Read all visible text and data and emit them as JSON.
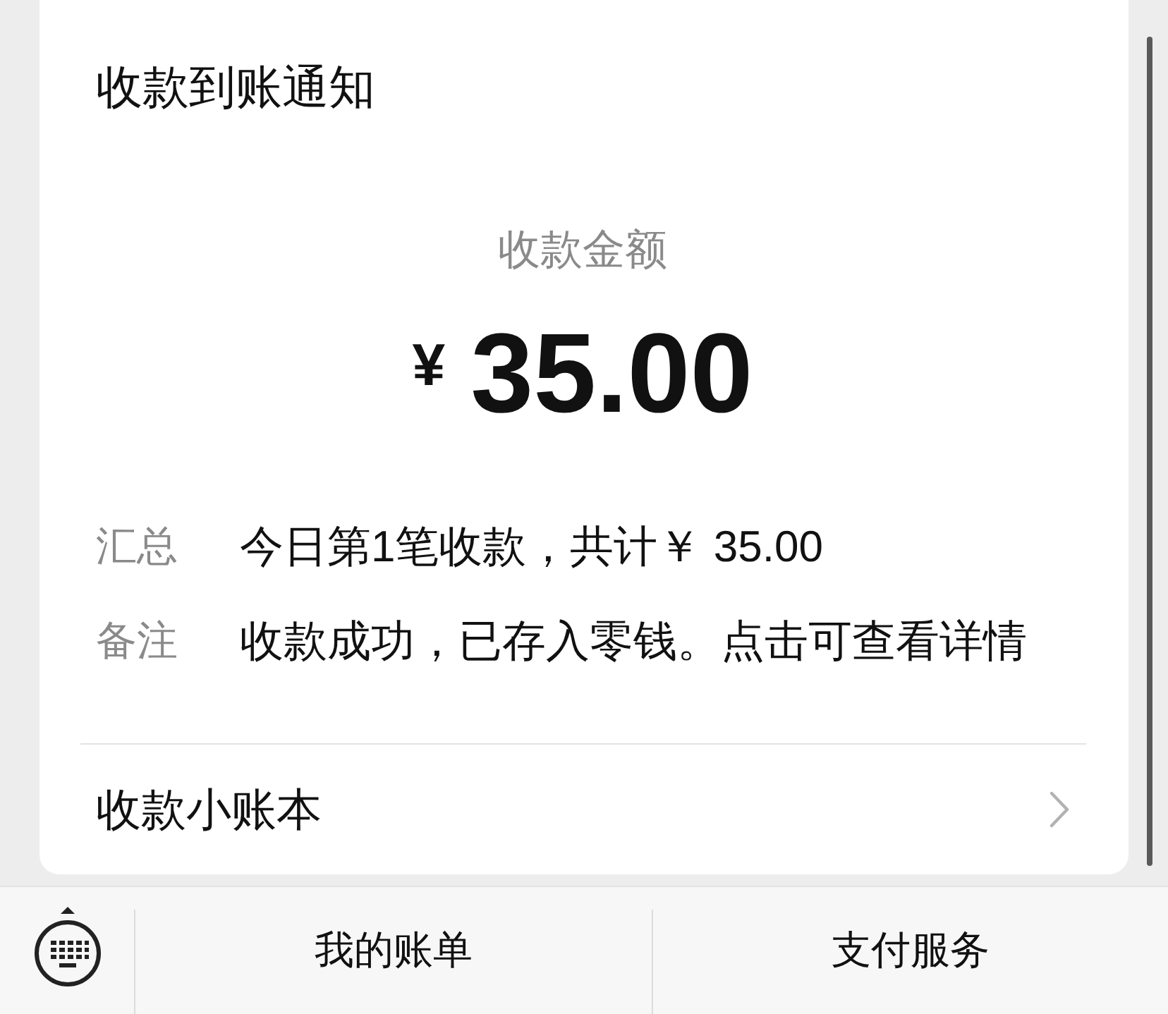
{
  "card": {
    "title": "收款到账通知",
    "amount_label": "收款金额",
    "currency": "¥",
    "amount": "35.00",
    "details": [
      {
        "label": "汇总",
        "value": "今日第1笔收款，共计￥ 35.00"
      },
      {
        "label": "备注",
        "value": "收款成功，已存入零钱。点击可查看详情"
      }
    ],
    "link": {
      "label": "收款小账本"
    }
  },
  "bottom_bar": {
    "menus": [
      {
        "label": "我的账单"
      },
      {
        "label": "支付服务"
      }
    ]
  }
}
